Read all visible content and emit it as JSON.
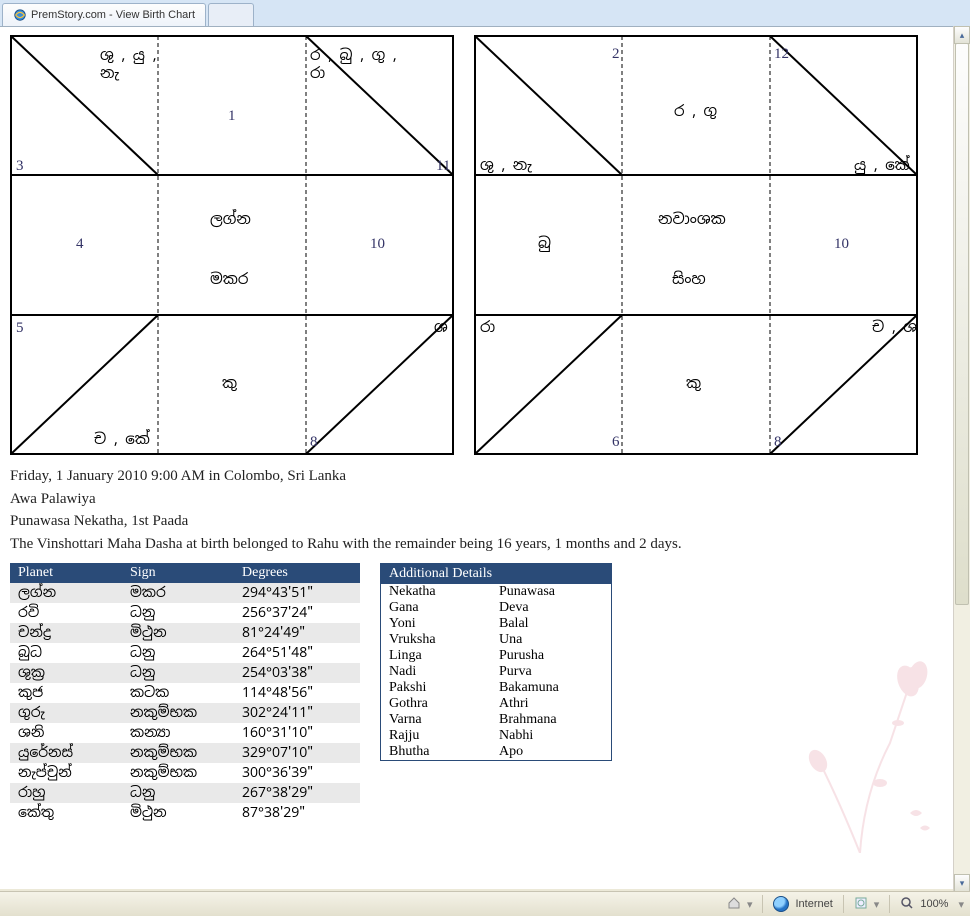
{
  "window": {
    "title": "PremStory.com - View Birth Chart"
  },
  "chart_left": {
    "center_top": "ලග්න",
    "center_bottom": "මකර",
    "h1": "1",
    "h3": "3",
    "h4": "4",
    "h5": "5",
    "h8": "8",
    "h10": "10",
    "h11": "11",
    "t_topA": "ශු , යු , \nනැ",
    "t_topB": "ර , බු , ගු , \nරා",
    "t_rightB": "ශ",
    "t_bottom": "කු",
    "t_leftB": "ච , කේ"
  },
  "chart_right": {
    "center_top": "නවාංශක",
    "center_bottom": "සිංහ",
    "n2": "2",
    "n12": "12",
    "n6": "6",
    "n8": "8",
    "n10": "10",
    "t_top_mid": "ර , ගු",
    "t_left_mid": "ශු , නැ",
    "t_right_mid": "යු , කේ",
    "t_center_left": "බු",
    "t_bl": "රා",
    "t_br": "ච , ශ",
    "t_bottom": "කු"
  },
  "info": {
    "line1": "Friday, 1 January 2010 9:00 AM in Colombo, Sri Lanka",
    "line2": "Awa Palawiya",
    "line3": "Punawasa Nekatha, 1st Paada",
    "line4": "The Vinshottari Maha Dasha at birth belonged to Rahu with the remainder being 16 years, 1 months and 2 days."
  },
  "planet_table": {
    "headers": {
      "c0": "Planet",
      "c1": "Sign",
      "c2": "Degrees"
    },
    "rows": [
      {
        "p": "ලග්න",
        "s": "මකර",
        "d": "294°43'51\""
      },
      {
        "p": "රවි",
        "s": "ධනු",
        "d": "256°37'24\""
      },
      {
        "p": "චන්ද්‍ර",
        "s": "මිථුන",
        "d": "81°24'49\""
      },
      {
        "p": "බුධ",
        "s": "ධනු",
        "d": "264°51'48\""
      },
      {
        "p": "ශුක්‍ර",
        "s": "ධනු",
        "d": "254°03'38\""
      },
      {
        "p": "කුජ",
        "s": "කටක",
        "d": "114°48'56\""
      },
      {
        "p": "ගුරු",
        "s": "නකුම්භක",
        "d": "302°24'11\""
      },
      {
        "p": "ශනි",
        "s": "කන්‍යා",
        "d": "160°31'10\""
      },
      {
        "p": "යුරේනස්",
        "s": "නකුම්භක",
        "d": "329°07'10\""
      },
      {
        "p": "නැප්චුන්",
        "s": "නකුම්භක",
        "d": "300°36'39\""
      },
      {
        "p": "රාහු",
        "s": "ධනු",
        "d": "267°38'29\""
      },
      {
        "p": "කේතු",
        "s": "මිථුන",
        "d": "87°38'29\""
      }
    ]
  },
  "details_table": {
    "header": "Additional Details",
    "rows": [
      {
        "k": "Nekatha",
        "v": "Punawasa"
      },
      {
        "k": "Gana",
        "v": "Deva"
      },
      {
        "k": "Yoni",
        "v": "Balal"
      },
      {
        "k": "Vruksha",
        "v": "Una"
      },
      {
        "k": "Linga",
        "v": "Purusha"
      },
      {
        "k": "Nadi",
        "v": "Purva"
      },
      {
        "k": "Pakshi",
        "v": "Bakamuna"
      },
      {
        "k": "Gothra",
        "v": "Athri"
      },
      {
        "k": "Varna",
        "v": "Brahmana"
      },
      {
        "k": "Rajju",
        "v": "Nabhi"
      },
      {
        "k": "Bhutha",
        "v": "Apo"
      }
    ]
  },
  "status": {
    "zone": "Internet",
    "zoom": "100%"
  }
}
